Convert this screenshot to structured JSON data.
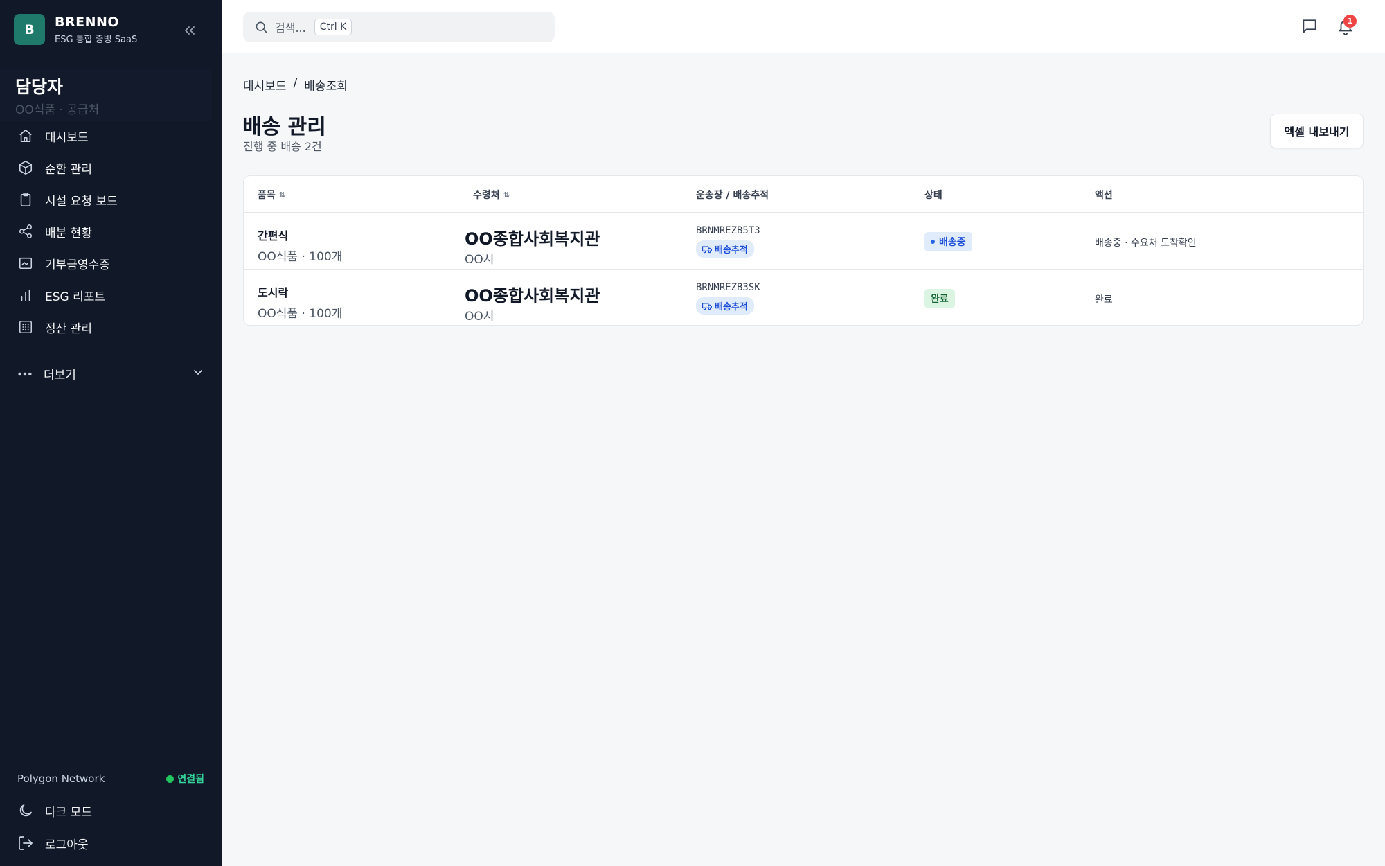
{
  "brand": {
    "logo_letter": "B",
    "name": "BRENNO",
    "subtitle": "ESG 통합 증빙 SaaS"
  },
  "user": {
    "name": "담당자",
    "org": "OO식품 · 공급처"
  },
  "sidebar": {
    "items": [
      {
        "label": "대시보드",
        "icon": "home-icon"
      },
      {
        "label": "순환 관리",
        "icon": "box-icon"
      },
      {
        "label": "시설 요청 보드",
        "icon": "clipboard-icon"
      },
      {
        "label": "배분 현황",
        "icon": "share-icon"
      },
      {
        "label": "기부금영수증",
        "icon": "receipt-icon"
      },
      {
        "label": "ESG 리포트",
        "icon": "bar-chart-icon"
      },
      {
        "label": "정산 관리",
        "icon": "calculator-icon"
      }
    ],
    "more_label": "더보기",
    "network_label": "Polygon Network",
    "network_status": "연결됨",
    "dark_mode_label": "다크 모드",
    "logout_label": "로그아웃"
  },
  "topbar": {
    "search_placeholder": "검색...",
    "search_shortcut": "Ctrl K",
    "notification_count": "1"
  },
  "breadcrumb": {
    "root": "대시보드",
    "separator": "/",
    "current": "배송조회"
  },
  "page": {
    "title": "배송 관리",
    "subtitle": "진행 중 배송 2건",
    "export_label": "엑셀 내보내기"
  },
  "table": {
    "headers": {
      "item": "품목",
      "recipient": "수령처",
      "waybill": "운송장 / 배송추적",
      "status": "상태",
      "action": "액션"
    },
    "rows": [
      {
        "item": "간편식",
        "item_meta": "OO식품 · 100개",
        "recipient": "OO종합사회복지관",
        "recipient_city": "OO시",
        "waybill": "BRNMREZB5T3",
        "track_label": "배송추적",
        "status": "배송중",
        "status_type": "shipping",
        "action": "배송중 · 수요처 도착확인"
      },
      {
        "item": "도시락",
        "item_meta": "OO식품 · 100개",
        "recipient": "OO종합사회복지관",
        "recipient_city": "OO시",
        "waybill": "BRNMREZB3SK",
        "track_label": "배송추적",
        "status": "완료",
        "status_type": "done",
        "action": "완료"
      }
    ]
  },
  "colors": {
    "sidebar_bg": "#111827",
    "accent": "#1f7a6c",
    "status_shipping": "#1d4ed8",
    "status_done": "#166534",
    "badge": "#ef4444"
  }
}
